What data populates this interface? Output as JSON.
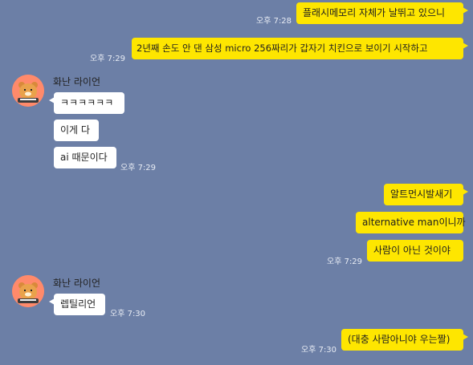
{
  "colors": {
    "background": "#6c7fa6",
    "my_bubble": "#fee600",
    "their_bubble": "#ffffff",
    "avatar_bg": "#ff8a6b"
  },
  "messages": {
    "m1": {
      "text": "플래시메모리 자체가 날뛰고 있으니",
      "time": "오후 7:28"
    },
    "m2": {
      "text": "2년째 손도 안 댄 삼성 micro 256짜리가 갑자기 치킨으로 보이기 시작하고",
      "time": "오후 7:29"
    },
    "sender1": {
      "name": "화난 라이언",
      "avatar_icon": "ryan-avatar-icon"
    },
    "m3": {
      "text": "ㅋㅋㅋㅋㅋㅋ"
    },
    "m4": {
      "text": "이게 다"
    },
    "m5": {
      "text": "ai 때문이다",
      "time": "오후 7:29"
    },
    "m6": {
      "text": "알트먼시발새기"
    },
    "m7": {
      "text": "alternative man이니까"
    },
    "m8": {
      "text": "사람이 아닌 것이야",
      "time": "오후 7:29"
    },
    "sender2": {
      "name": "화난 라이언",
      "avatar_icon": "ryan-avatar-icon"
    },
    "m9": {
      "text": "렙틸리언",
      "time": "오후 7:30"
    },
    "m10": {
      "text": "(대충 사람아니야 우는짤)",
      "time": "오후 7:30"
    }
  }
}
